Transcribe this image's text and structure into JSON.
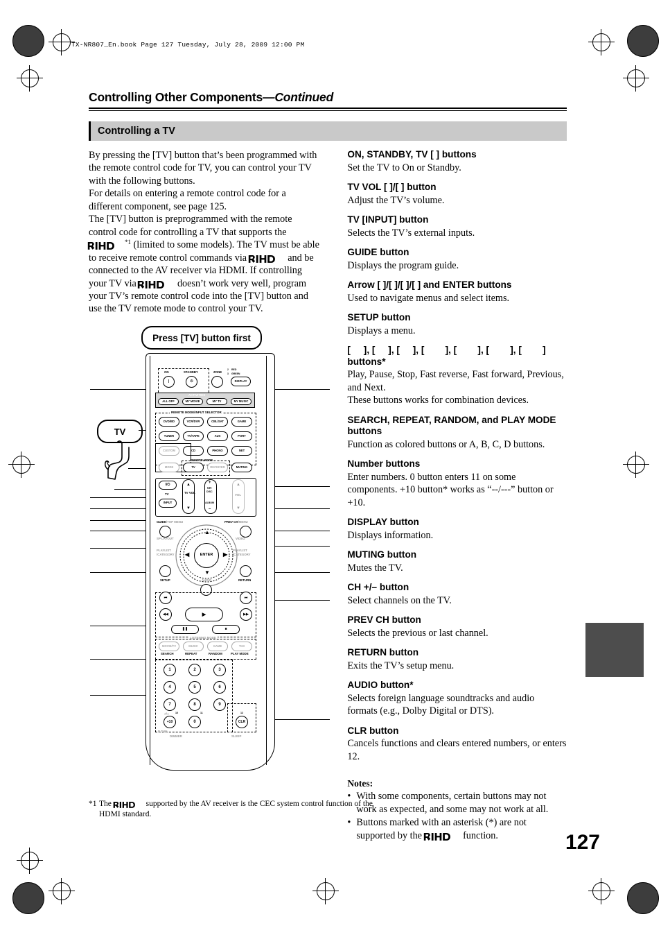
{
  "header": {
    "file_line": "TX-NR807_En.book   Page 127   Tuesday, July 28, 2009   12:00 PM"
  },
  "page": {
    "title_main": "Controlling Other Components",
    "title_continued": "—Continued",
    "section_title": "Controlling a TV",
    "page_number": "127"
  },
  "left_column": {
    "para1": "By pressing the [TV] button that’s been programmed with the remote control code for TV, you can control your TV with the following buttons.",
    "para2": "For details on entering a remote control code for a different component, see page 125.",
    "para3_a": "The [TV] button is preprogrammed with the remote control code for controlling a TV that supports the",
    "para3_footnote_marker": "*1",
    "para3_b": "(limited to some models). The TV must be able to receive remote control commands via",
    "para3_c": "and be connected to the AV receiver via HDMI. If controlling your TV via",
    "para3_d": "doesn’t work very well, program your TV’s remote control code into the [TV] button and use the TV remote mode to control your TV."
  },
  "right_column": {
    "entries": [
      {
        "heading": "ON, STANDBY, TV [     ] buttons",
        "desc": "Set the TV to On or Standby."
      },
      {
        "heading": "TV VOL [   ]/[   ] button",
        "desc": "Adjust the TV’s volume."
      },
      {
        "heading": "TV [INPUT] button",
        "desc": "Selects the TV’s external inputs."
      },
      {
        "heading": "GUIDE button",
        "desc": "Displays the program guide."
      },
      {
        "heading": "Arrow [   ]/[   ]/[   ]/[   ] and ENTER buttons",
        "desc": "Used to navigate menus and select items."
      },
      {
        "heading": "SETUP button",
        "desc": "Displays a menu."
      },
      {
        "heading": "[     ], [     ], [     ], [        ], [        ], [        ], [        ] buttons*",
        "desc": "Play, Pause, Stop, Fast reverse, Fast forward, Previous, and Next.\nThese buttons works for combination devices."
      },
      {
        "heading": "SEARCH, REPEAT, RANDOM, and PLAY MODE buttons",
        "desc": "Function as colored buttons or A, B, C, D buttons."
      },
      {
        "heading": "Number buttons",
        "desc": "Enter numbers. 0 button enters 11 on some components. +10 button* works as “--/---” button or +10."
      },
      {
        "heading": "DISPLAY button",
        "desc": "Displays information."
      },
      {
        "heading": "MUTING button",
        "desc": "Mutes the TV."
      },
      {
        "heading": "CH +/– button",
        "desc": "Select channels on the TV."
      },
      {
        "heading": "PREV CH button",
        "desc": "Selects the previous or last channel."
      },
      {
        "heading": "RETURN button",
        "desc": "Exits the TV’s setup menu."
      },
      {
        "heading": "AUDIO button*",
        "desc": "Selects foreign language soundtracks and audio formats (e.g., Dolby Digital or DTS)."
      },
      {
        "heading": "CLR button",
        "desc": "Cancels functions and clears entered numbers, or enters 12."
      }
    ]
  },
  "notes": {
    "title": "Notes:",
    "items": [
      "With some components, certain buttons may not work as expected, and some may not work at all.",
      "Buttons marked with an asterisk (*) are not supported by the"
    ],
    "item2_tail": "function."
  },
  "footnote": {
    "marker": "*1",
    "text_a": "The",
    "text_b": "supported by the AV receiver is the CEC system control function of the HDMI standard."
  },
  "illustration": {
    "callout_press_tv": "Press [TV] button first",
    "callout_tv": "TV",
    "top_row": {
      "on": "ON",
      "standby": "STANDBY",
      "zone": "ZONE",
      "zone2": "2",
      "zone3": "3",
      "red": "RED",
      "green": "GREEN",
      "display": "DISPLAY"
    },
    "activities": {
      "title": "ACTIVITIES",
      "buttons": [
        "ALL OFF",
        "MY MOVIE",
        "MY TV",
        "MY MUSIC"
      ]
    },
    "remote_mode_title": "REMOTE MODE/INPUT SELECTOR",
    "input_selector": [
      "DVD/BD",
      "VCR/DVR",
      "CBL/SAT",
      "GAME",
      "TUNER",
      "TV/TAPE",
      "AUX",
      "PORT",
      "CUSTOM",
      "CD",
      "PHONO",
      "NET"
    ],
    "remote_mode_label": "REMOTE MODE",
    "mode_row": [
      "MODE",
      "TV",
      "RECEIVER",
      "MUTING"
    ],
    "power_row": {
      "power": "I/⏻",
      "tv": "TV",
      "input": "INPUT",
      "tvvol": "TV VOL",
      "ch": "CH",
      "disc": "DISC",
      "album": "ALBUM",
      "vol": "VOL",
      "plus": "+",
      "minus": "–"
    },
    "menu_row": {
      "guide": "GUIDE",
      "top_menu": "/TOP MENU",
      "prev_ch": "PREV CH",
      "menu": "/MENU"
    },
    "nav": {
      "enter": "ENTER",
      "sp_layout": "SP LAYOUT",
      "video": "VIDEO",
      "playlist_left": "PLAYLIST\n/CATEGORY",
      "playlist_right": "PLAYLIST\n/CATEGORY",
      "setup": "SETUP",
      "return": "RETURN",
      "audio": "AUDIO"
    },
    "listening_mode_title": "LISTENING MODE",
    "listening_buttons": [
      "MOVIE/TV",
      "MUSIC",
      "GAME",
      "THX"
    ],
    "listening_sublabels": [
      "SEARCH",
      "REPEAT",
      "RANDOM",
      "PLAY MODE"
    ],
    "numbers": [
      "1",
      "2",
      "3",
      "4",
      "5",
      "6",
      "7",
      "8",
      "9",
      "+10",
      "0",
      "CLR"
    ],
    "number_sub": {
      "ten": "10",
      "eleven": "11",
      "twelve": "12",
      "dash": "--/---",
      "dtun": "D.TUN",
      "dimmer": "DIMMER",
      "sleep": "SLEEP"
    }
  },
  "colors": {
    "section_bar": "#c9c9c9",
    "thumb_tab": "#4d4d4d",
    "registration": "#3d3d3d"
  }
}
